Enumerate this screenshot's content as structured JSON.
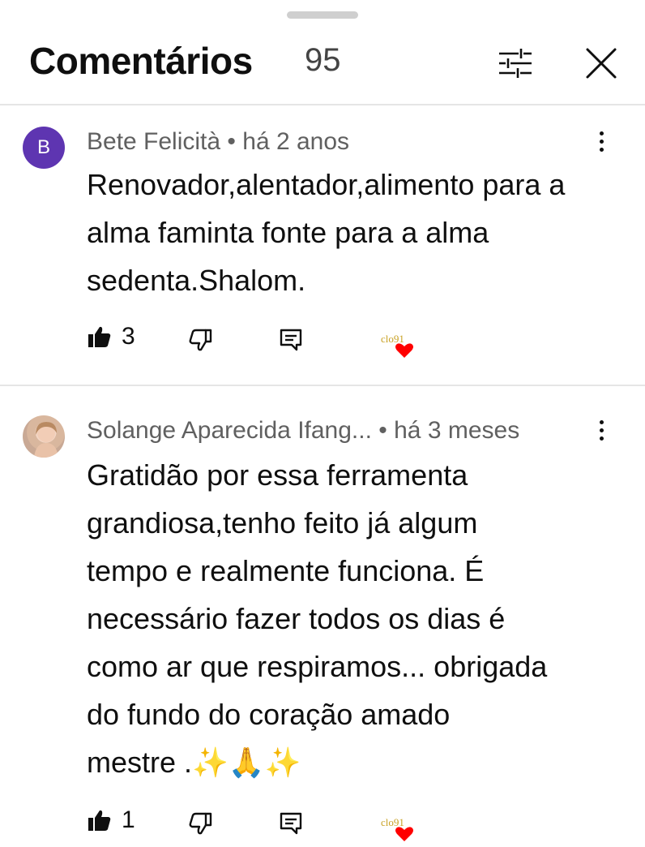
{
  "header": {
    "title": "Comentários",
    "count": "95",
    "filter_icon": "sliders-icon",
    "close_icon": "close-icon"
  },
  "comments": [
    {
      "avatar_letter": "B",
      "avatar_color": "#5e35b1",
      "author": "Bete Felicità",
      "time": "• há 2 anos",
      "lines": [
        "Renovador,alentador,alimento para a",
        "alma faminta fonte para a alma",
        "sedenta.Shalom."
      ],
      "likes": "3",
      "creator_badge": "clo91"
    },
    {
      "avatar_letter": "",
      "author": "Solange Aparecida Ifang...",
      "time": "• há 3 meses",
      "lines": [
        "Gratidão por essa ferramenta",
        "grandiosa,tenho feito já algum",
        "tempo e realmente funciona. É",
        "necessário fazer todos os dias é",
        "como ar que respiramos... obrigada",
        "do fundo do coração amado",
        "mestre .✨🙏✨"
      ],
      "likes": "1",
      "creator_badge": "clo91"
    }
  ],
  "colors": {
    "text": "#0f0f0f",
    "meta": "#606060",
    "heart": "#ff0000",
    "divider": "#e5e5e5"
  }
}
